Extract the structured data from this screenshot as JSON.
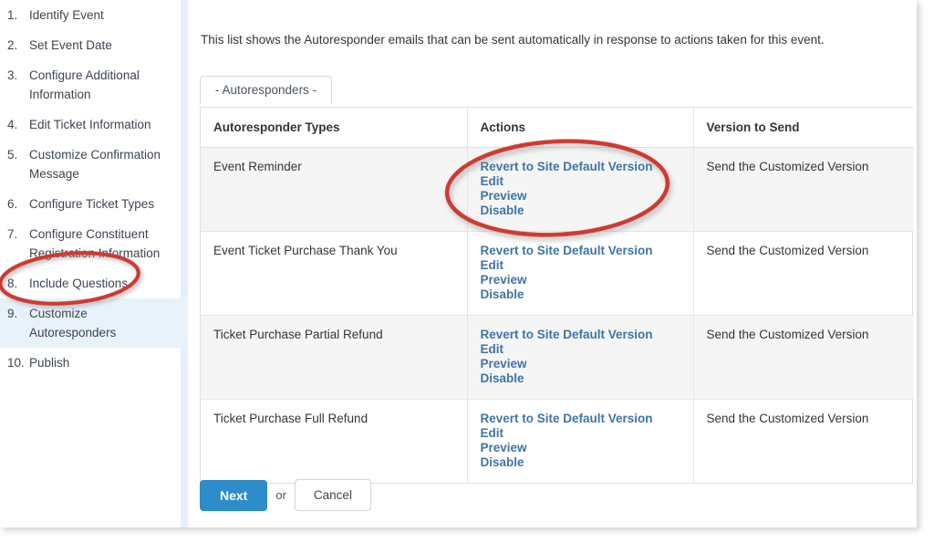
{
  "sidebar": {
    "items": [
      {
        "num": "1.",
        "label": "Identify Event",
        "active": false
      },
      {
        "num": "2.",
        "label": "Set Event Date",
        "active": false
      },
      {
        "num": "3.",
        "label": "Configure Additional Information",
        "active": false
      },
      {
        "num": "4.",
        "label": "Edit Ticket Information",
        "active": false
      },
      {
        "num": "5.",
        "label": "Customize Confirmation Message",
        "active": false
      },
      {
        "num": "6.",
        "label": "Configure Ticket Types",
        "active": false
      },
      {
        "num": "7.",
        "label": "Configure Constituent Registration Information",
        "active": false
      },
      {
        "num": "8.",
        "label": "Include Questions",
        "active": false
      },
      {
        "num": "9.",
        "label": "Customize Autoresponders",
        "active": true
      },
      {
        "num": "10.",
        "label": "Publish",
        "active": false
      }
    ]
  },
  "main": {
    "intro": "This list shows the Autoresponder emails that can be sent automatically in response to actions taken for this event.",
    "tab_label": "- Autoresponders -",
    "table": {
      "headers": [
        "Autoresponder Types",
        "Actions",
        "Version to Send"
      ],
      "rows": [
        {
          "type": "Event Reminder",
          "actions": [
            "Revert to Site Default Version",
            "Edit",
            "Preview",
            "Disable"
          ],
          "version": "Send the Customized Version"
        },
        {
          "type": "Event Ticket Purchase Thank You",
          "actions": [
            "Revert to Site Default Version",
            "Edit",
            "Preview",
            "Disable"
          ],
          "version": "Send the Customized Version"
        },
        {
          "type": "Ticket Purchase Partial Refund",
          "actions": [
            "Revert to Site Default Version",
            "Edit",
            "Preview",
            "Disable"
          ],
          "version": "Send the Customized Version"
        },
        {
          "type": "Ticket Purchase Full Refund",
          "actions": [
            "Revert to Site Default Version",
            "Edit",
            "Preview",
            "Disable"
          ],
          "version": "Send the Customized Version"
        }
      ]
    }
  },
  "footer": {
    "next_label": "Next",
    "or_label": "or",
    "cancel_label": "Cancel"
  },
  "annotations": {
    "color": "#cc3b33"
  }
}
